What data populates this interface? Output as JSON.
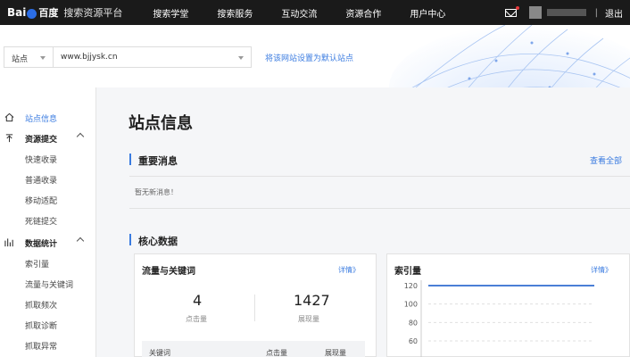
{
  "header": {
    "logo_text": "Bai",
    "logo_cn": "百度",
    "platform": "搜索资源平台",
    "nav": [
      "搜索学堂",
      "搜索服务",
      "互动交流",
      "资源合作",
      "用户中心"
    ],
    "separator": "|",
    "logout": "退出"
  },
  "sitebar": {
    "site_label": "站点",
    "site_value": "www.bjjysk.cn",
    "default_link": "将该网站设置为默认站点"
  },
  "sidebar": {
    "items": [
      {
        "label": "站点信息",
        "type": "active",
        "icon": "home-icon"
      },
      {
        "label": "资源提交",
        "type": "group",
        "icon": "upload-icon"
      },
      {
        "label": "快速收录",
        "type": "sub"
      },
      {
        "label": "普通收录",
        "type": "sub"
      },
      {
        "label": "移动适配",
        "type": "sub"
      },
      {
        "label": "死链提交",
        "type": "sub"
      },
      {
        "label": "数据统计",
        "type": "group",
        "icon": "stats-icon"
      },
      {
        "label": "索引量",
        "type": "sub"
      },
      {
        "label": "流量与关键词",
        "type": "sub"
      },
      {
        "label": "抓取频次",
        "type": "sub"
      },
      {
        "label": "抓取诊断",
        "type": "sub"
      },
      {
        "label": "抓取异常",
        "type": "sub"
      }
    ]
  },
  "main": {
    "page_title": "站点信息",
    "important": {
      "title": "重要消息",
      "view_all": "查看全部",
      "empty": "暂无新消息！"
    },
    "core": {
      "title": "核心数据",
      "traffic_card": {
        "title": "流量与关键词",
        "detail": "详情》",
        "clicks_value": "4",
        "clicks_label": "点击量",
        "impressions_value": "1427",
        "impressions_label": "展现量",
        "table_headers": [
          "关键词",
          "点击量",
          "展现量"
        ]
      },
      "index_card": {
        "title": "索引量",
        "detail": "详情》"
      }
    }
  },
  "chart_data": {
    "type": "line",
    "title": "",
    "y_ticks": [
      120,
      100,
      80,
      60
    ],
    "ylim": [
      50,
      125
    ],
    "series": [
      {
        "values": [
          120,
          120,
          120,
          120,
          120,
          120,
          120
        ]
      }
    ],
    "line_color": "#4a7fd6"
  }
}
